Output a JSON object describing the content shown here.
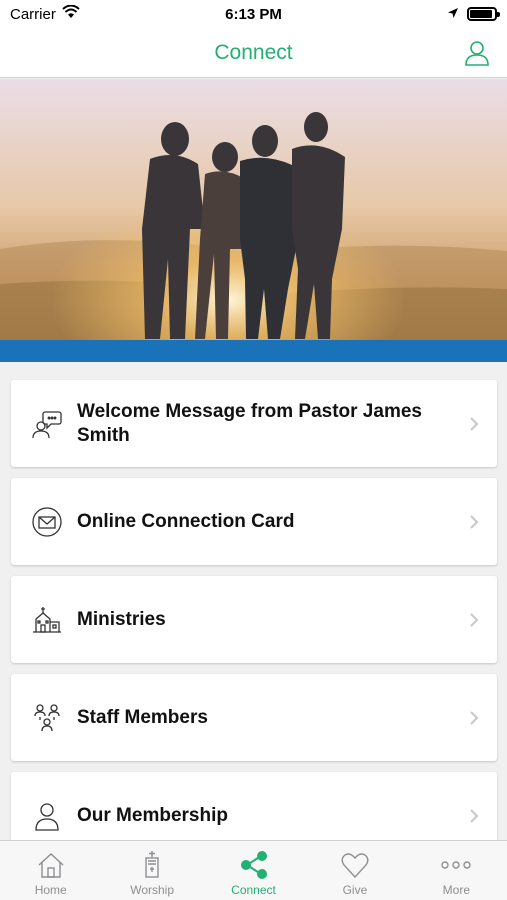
{
  "status_bar": {
    "carrier": "Carrier",
    "time": "6:13 PM"
  },
  "nav": {
    "title": "Connect",
    "profile_icon": "user-profile-icon"
  },
  "colors": {
    "accent": "#22b073",
    "hero_band": "#1a72b8"
  },
  "list": {
    "items": [
      {
        "label": "Welcome Message from Pastor James Smith",
        "icon": "pastor-message-icon"
      },
      {
        "label": "Online Connection Card",
        "icon": "envelope-icon"
      },
      {
        "label": "Ministries",
        "icon": "church-building-icon"
      },
      {
        "label": "Staff Members",
        "icon": "staff-group-icon"
      },
      {
        "label": "Our Membership",
        "icon": "member-icon"
      }
    ]
  },
  "tabs": [
    {
      "label": "Home",
      "icon": "home-icon",
      "active": false
    },
    {
      "label": "Worship",
      "icon": "worship-icon",
      "active": false
    },
    {
      "label": "Connect",
      "icon": "share-icon",
      "active": true
    },
    {
      "label": "Give",
      "icon": "heart-icon",
      "active": false
    },
    {
      "label": "More",
      "icon": "more-icon",
      "active": false
    }
  ]
}
